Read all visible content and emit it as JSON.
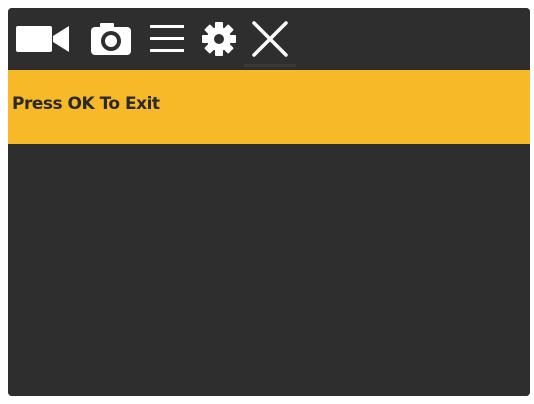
{
  "toolbar": {
    "icons": [
      "video-camera-icon",
      "camera-icon",
      "menu-icon",
      "settings-gear-icon",
      "close-icon"
    ],
    "selected": "close-icon"
  },
  "banner": {
    "text": "Press OK To Exit"
  },
  "colors": {
    "accent": "#f7b928",
    "background": "#2e2e2e",
    "icon": "#ffffff"
  }
}
